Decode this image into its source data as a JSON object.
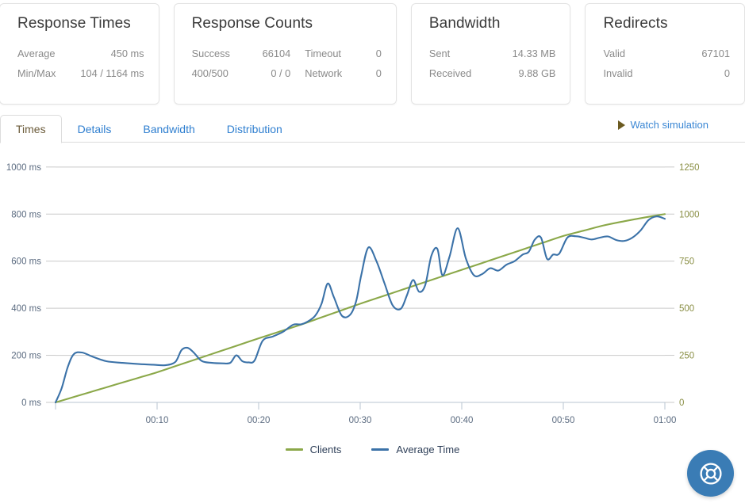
{
  "cards": [
    {
      "title": "Response Times",
      "rows": [
        {
          "label": "Average",
          "value": "450 ms"
        },
        {
          "label": "Min/Max",
          "value": "104 / 1164 ms"
        }
      ]
    },
    {
      "title": "Response Counts",
      "rows": [
        {
          "label": "Success",
          "value": "66104",
          "label2": "Timeout",
          "value2": "0"
        },
        {
          "label": "400/500",
          "value": "0 / 0",
          "label2": "Network",
          "value2": "0"
        }
      ]
    },
    {
      "title": "Bandwidth",
      "rows": [
        {
          "label": "Sent",
          "value": "14.33 MB"
        },
        {
          "label": "Received",
          "value": "9.88 GB"
        }
      ]
    },
    {
      "title": "Redirects",
      "rows": [
        {
          "label": "Valid",
          "value": "67101"
        },
        {
          "label": "Invalid",
          "value": "0"
        }
      ]
    }
  ],
  "tabs": [
    {
      "label": "Times",
      "active": true
    },
    {
      "label": "Details",
      "active": false
    },
    {
      "label": "Bandwidth",
      "active": false
    },
    {
      "label": "Distribution",
      "active": false
    }
  ],
  "watch_simulation": {
    "label": "Watch simulation",
    "icon": "play-triangle-icon"
  },
  "help_button": {
    "icon": "lifebuoy-icon"
  },
  "colors": {
    "clients_line": "#8ba849",
    "average_time_line": "#3b72a8",
    "tab_link": "#2f7fd0",
    "tab_active_text": "#6b5b3a",
    "left_axis_text": "#5b6b80",
    "right_axis_text": "#8a8f45",
    "gridline": "#c9c9c9",
    "fab_background": "#3a7cb5"
  },
  "chart_data": {
    "type": "line",
    "title": "",
    "xlabel": "",
    "grid": true,
    "legend_position": "bottom",
    "x_ticks": [
      "00:10",
      "00:20",
      "00:30",
      "00:40",
      "00:50",
      "01:00"
    ],
    "x_tick_values": [
      10,
      20,
      30,
      40,
      50,
      60
    ],
    "xlim": [
      0,
      60
    ],
    "left_axis": {
      "label": "Average Time",
      "unit": "ms",
      "ticks": [
        "0 ms",
        "200 ms",
        "400 ms",
        "600 ms",
        "800 ms",
        "1000 ms"
      ],
      "tick_values": [
        0,
        200,
        400,
        600,
        800,
        1000
      ],
      "ylim": [
        0,
        1060
      ]
    },
    "right_axis": {
      "label": "Clients",
      "unit": "",
      "ticks": [
        "0",
        "250",
        "500",
        "750",
        "1000",
        "1250"
      ],
      "tick_values": [
        0,
        250,
        500,
        750,
        1000,
        1250
      ],
      "ylim": [
        0,
        1325
      ]
    },
    "series": [
      {
        "name": "Clients",
        "axis": "right",
        "color": "#8ba849",
        "x": [
          0,
          2,
          4,
          6,
          8,
          10,
          12,
          14,
          16,
          18,
          20,
          22,
          24,
          26,
          28,
          30,
          32,
          34,
          36,
          38,
          40,
          42,
          44,
          46,
          48,
          50,
          52,
          54,
          56,
          58,
          60
        ],
        "values": [
          0,
          32,
          64,
          96,
          128,
          160,
          196,
          232,
          268,
          304,
          340,
          375,
          410,
          448,
          486,
          524,
          560,
          596,
          632,
          668,
          704,
          740,
          776,
          812,
          848,
          884,
          912,
          940,
          962,
          982,
          1000
        ]
      },
      {
        "name": "Average Time",
        "axis": "left",
        "color": "#3b72a8",
        "x": [
          0.0,
          0.6,
          1.2,
          1.8,
          2.6,
          3.6,
          5.0,
          6.6,
          8.2,
          9.6,
          10.8,
          11.8,
          12.4,
          13.0,
          13.6,
          14.4,
          15.4,
          16.4,
          17.2,
          17.8,
          18.4,
          19.0,
          19.6,
          20.4,
          21.4,
          22.4,
          23.4,
          24.2,
          25.0,
          25.6,
          26.2,
          26.8,
          27.4,
          28.2,
          29.0,
          29.6,
          30.1,
          30.8,
          31.6,
          32.4,
          33.2,
          34.0,
          34.6,
          35.2,
          35.8,
          36.4,
          37.0,
          37.6,
          38.1,
          38.8,
          39.6,
          40.4,
          41.2,
          42.0,
          42.8,
          43.6,
          44.4,
          45.2,
          46.0,
          46.6,
          47.2,
          47.8,
          48.4,
          49.0,
          49.6,
          50.4,
          51.2,
          52.0,
          52.8,
          53.6,
          54.4,
          55.2,
          56.0,
          56.8,
          57.6,
          58.4,
          59.2,
          60.0
        ],
        "values": [
          0,
          60,
          150,
          205,
          212,
          195,
          175,
          168,
          163,
          160,
          158,
          172,
          222,
          232,
          212,
          176,
          168,
          166,
          168,
          200,
          175,
          170,
          178,
          262,
          280,
          300,
          330,
          332,
          348,
          370,
          420,
          505,
          448,
          368,
          372,
          430,
          540,
          658,
          600,
          505,
          412,
          398,
          455,
          520,
          470,
          498,
          622,
          652,
          540,
          620,
          740,
          612,
          540,
          545,
          570,
          560,
          585,
          600,
          628,
          640,
          692,
          700,
          610,
          628,
          632,
          700,
          706,
          700,
          692,
          700,
          705,
          690,
          686,
          700,
          730,
          775,
          790,
          780
        ]
      }
    ]
  }
}
